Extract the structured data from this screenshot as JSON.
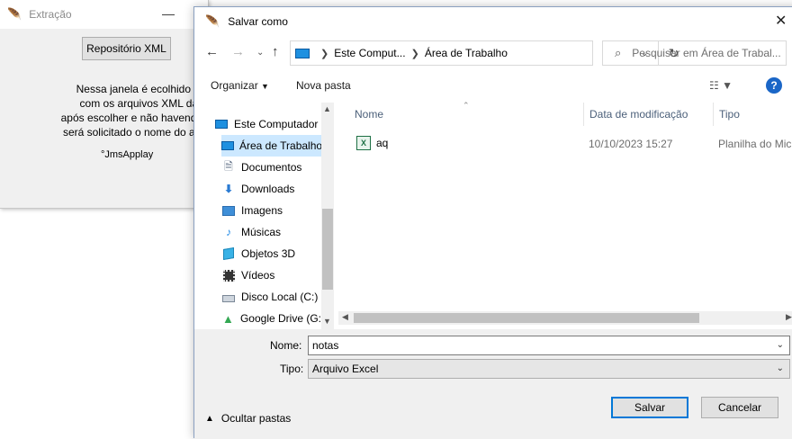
{
  "background_window": {
    "title": "Extração",
    "button_label": "Repositório XML",
    "description_lines": [
      "Nessa janela é ecolhido o diretó",
      "com os arquivos XML das NFs",
      "após escolher e não havendo erros no",
      "será solicitado o nome do arquivo par"
    ],
    "credit": "°JmsApplay"
  },
  "dialog": {
    "title": "Salvar como",
    "address": {
      "segments": [
        "Este Comput...",
        "Área de Trabalho"
      ]
    },
    "search": {
      "placeholder": "Pesquisar em Área de Trabal..."
    },
    "toolbar": {
      "organize_label": "Organizar",
      "new_folder_label": "Nova pasta"
    },
    "nav_items": [
      {
        "label": "Este Computador",
        "icon": "computer-icon",
        "selected": false,
        "indent": false
      },
      {
        "label": "Área de Trabalho",
        "icon": "desktop-icon",
        "selected": true,
        "indent": true
      },
      {
        "label": "Documentos",
        "icon": "documents-icon",
        "selected": false,
        "indent": true
      },
      {
        "label": "Downloads",
        "icon": "downloads-icon",
        "selected": false,
        "indent": true
      },
      {
        "label": "Imagens",
        "icon": "images-icon",
        "selected": false,
        "indent": true
      },
      {
        "label": "Músicas",
        "icon": "music-icon",
        "selected": false,
        "indent": true
      },
      {
        "label": "Objetos 3D",
        "icon": "objects3d-icon",
        "selected": false,
        "indent": true
      },
      {
        "label": "Vídeos",
        "icon": "videos-icon",
        "selected": false,
        "indent": true
      },
      {
        "label": "Disco Local (C:)",
        "icon": "drive-icon",
        "selected": false,
        "indent": true
      },
      {
        "label": "Google Drive (G:",
        "icon": "google-drive-icon",
        "selected": false,
        "indent": true
      }
    ],
    "columns": {
      "name": "Nome",
      "date": "Data de modificação",
      "type": "Tipo"
    },
    "files": [
      {
        "name": "aq",
        "date": "10/10/2023 15:27",
        "type": "Planilha do Mic",
        "icon": "excel-file-icon"
      }
    ],
    "form": {
      "name_label": "Nome:",
      "name_value": "notas",
      "type_label": "Tipo:",
      "type_value": "Arquivo Excel",
      "hide_folders_label": "Ocultar pastas",
      "save_label": "Salvar",
      "cancel_label": "Cancelar"
    }
  },
  "colors": {
    "selection": "#cce8ff",
    "accent": "#0078d7",
    "help": "#1a66c7"
  }
}
